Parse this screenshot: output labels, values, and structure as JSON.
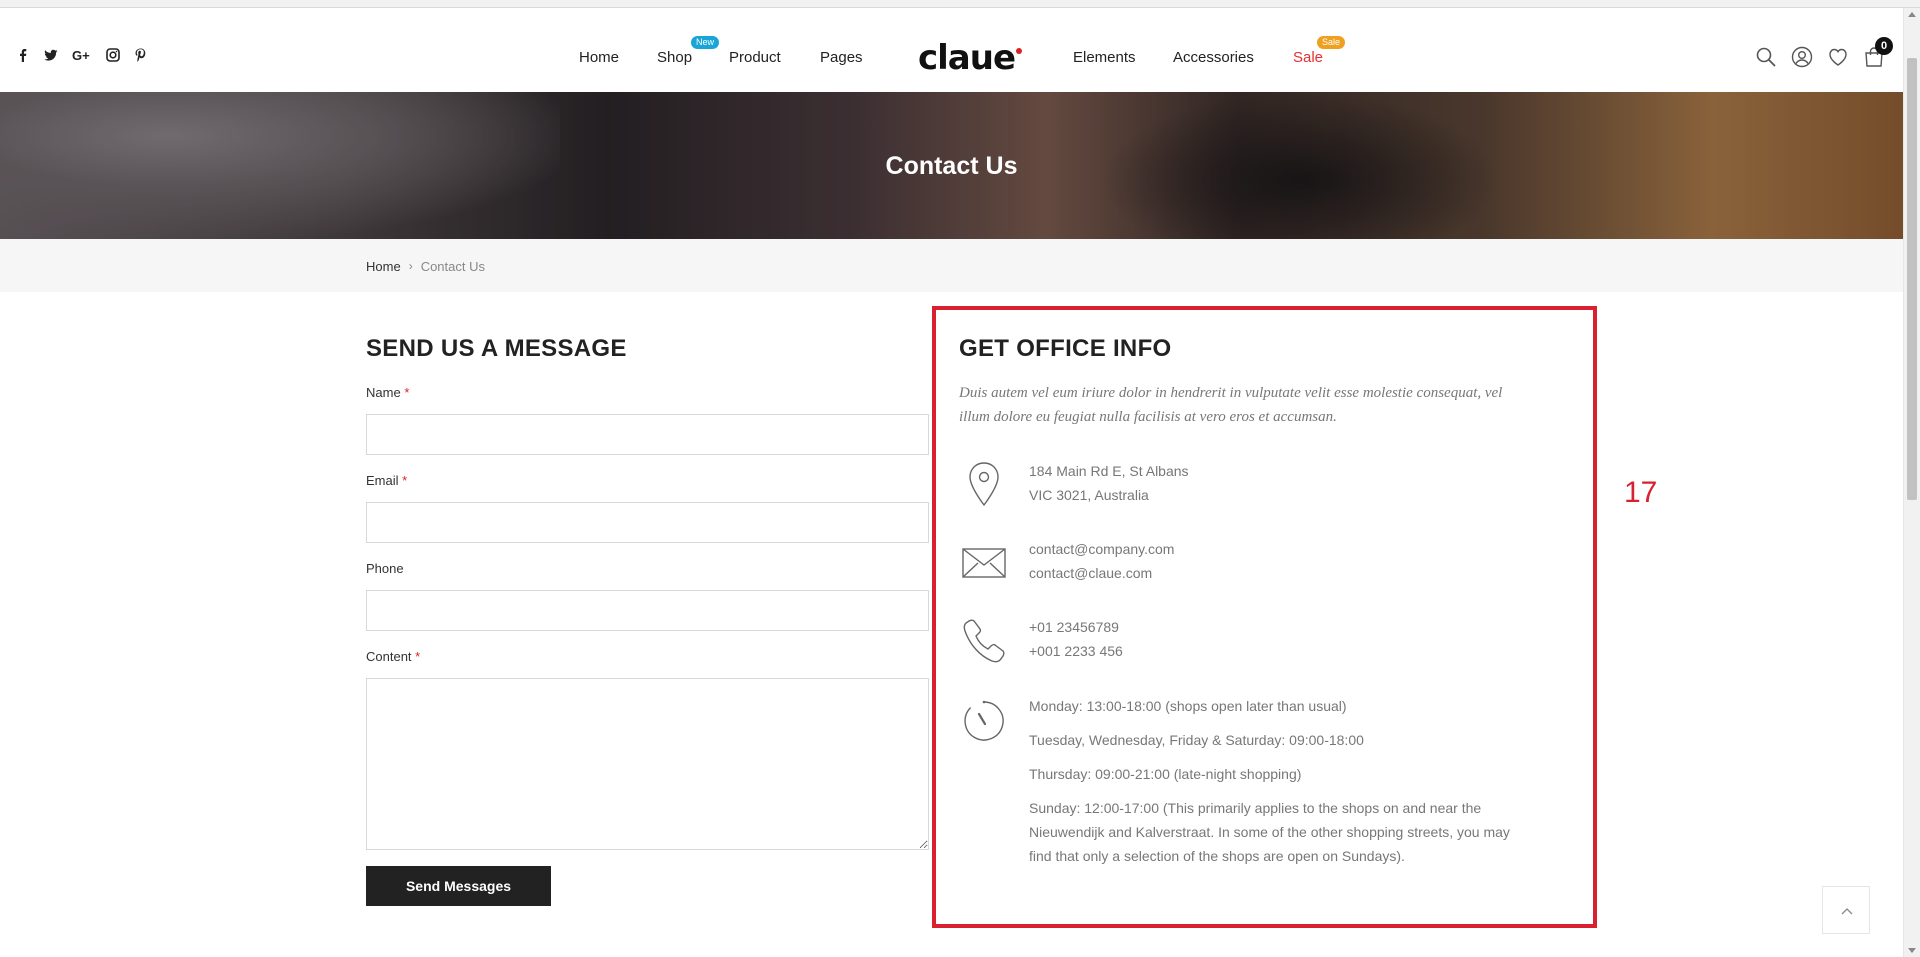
{
  "header": {
    "social": [
      "facebook-icon",
      "twitter-icon",
      "google-plus-icon",
      "instagram-icon",
      "pinterest-icon"
    ],
    "nav": [
      {
        "label": "Home"
      },
      {
        "label": "Shop",
        "badge": "New"
      },
      {
        "label": "Product"
      },
      {
        "label": "Pages"
      },
      {
        "label": "Elements"
      },
      {
        "label": "Accessories"
      },
      {
        "label": "Sale",
        "badge": "Sale"
      }
    ],
    "logo": "claue",
    "cart_count": "0",
    "icons": [
      "search-icon",
      "user-icon",
      "heart-icon",
      "cart-icon"
    ]
  },
  "hero": {
    "title": "Contact Us"
  },
  "breadcrumb": {
    "home": "Home",
    "separator": "›",
    "current": "Contact Us"
  },
  "form": {
    "title": "SEND US A MESSAGE",
    "fields": [
      {
        "label": "Name",
        "required": "*",
        "value": ""
      },
      {
        "label": "Email",
        "required": "*",
        "value": ""
      },
      {
        "label": "Phone",
        "required": "",
        "value": ""
      },
      {
        "label": "Content",
        "required": "*",
        "value": ""
      }
    ],
    "submit_label": "Send Messages"
  },
  "office": {
    "title": "GET OFFICE INFO",
    "description": "Duis autem vel eum iriure dolor in hendrerit in vulputate velit esse molestie consequat, vel illum dolore eu feugiat nulla facilisis at vero eros et accumsan.",
    "address": [
      "184 Main Rd E, St Albans",
      "VIC 3021, Australia"
    ],
    "emails": [
      "contact@company.com",
      "contact@claue.com"
    ],
    "phones": [
      "+01 23456789",
      "+001 2233 456"
    ],
    "hours": [
      "Monday: 13:00-18:00 (shops open later than usual)",
      "Tuesday, Wednesday, Friday & Saturday: 09:00-18:00",
      "Thursday: 09:00-21:00 (late-night shopping)",
      "Sunday: 12:00-17:00 (This primarily applies to the shops on and near the Nieuwendijk and Kalverstraat. In some of the other shopping streets, you may find that only a selection of the shops are open on Sundays)."
    ]
  },
  "annotation": {
    "number": "17"
  },
  "colors": {
    "accent": "#e02020",
    "annotation": "#d92030",
    "badge_new": "#1aa5d8",
    "badge_sale": "#f0a020",
    "button": "#222222"
  }
}
